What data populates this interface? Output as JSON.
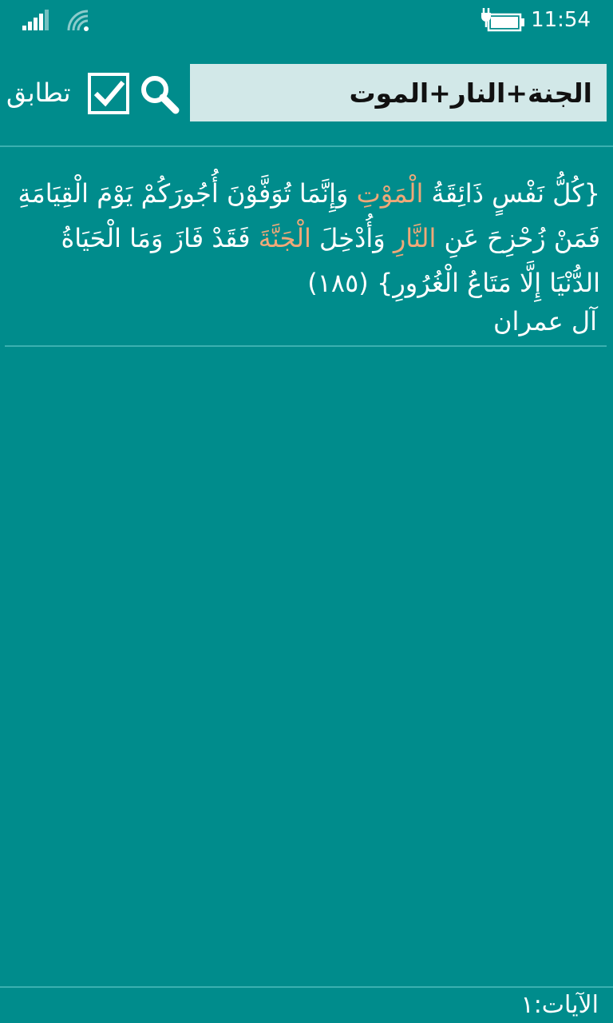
{
  "status_bar": {
    "time": "11:54"
  },
  "search": {
    "query": "الجنة+النار+الموت",
    "match_label": "تطابق",
    "match_checked": true
  },
  "results": [
    {
      "verse_parts": [
        {
          "text": "{كُلُّ نَفْسٍ ذَائِقَةُ ",
          "highlight": false
        },
        {
          "text": "الْمَوْتِ",
          "highlight": true
        },
        {
          "text": " وَإِنَّمَا تُوَفَّوْنَ أُجُورَكُمْ يَوْمَ الْقِيَامَةِ فَمَنْ زُحْزِحَ عَنِ ",
          "highlight": false
        },
        {
          "text": "النَّارِ",
          "highlight": true
        },
        {
          "text": " وَأُدْخِلَ ",
          "highlight": false
        },
        {
          "text": "الْجَنَّةَ",
          "highlight": true
        },
        {
          "text": " فَقَدْ فَازَ وَمَا الْحَيَاةُ الدُّنْيَا إِلَّا مَتَاعُ الْغُرُورِ} (١٨٥)",
          "highlight": false
        }
      ],
      "surah": "آل عمران"
    }
  ],
  "footer": {
    "count_text": "الآيات:١"
  },
  "colors": {
    "background": "#008c8c",
    "highlight": "#f0a878",
    "search_field": "#d2e8e8",
    "divider": "#3ab0b0"
  }
}
